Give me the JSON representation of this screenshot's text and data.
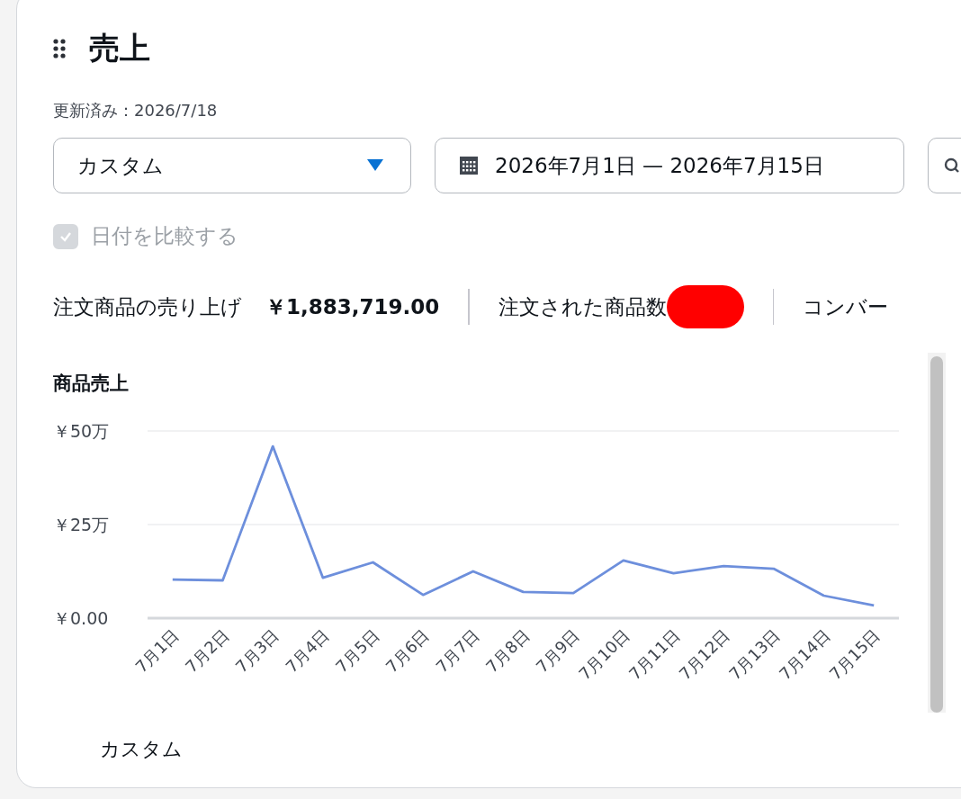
{
  "header": {
    "title": "売上",
    "updated": "更新済み：2026/7/18"
  },
  "controls": {
    "range_select": {
      "value": "カスタム"
    },
    "date_range": {
      "value": "2026年7月1日 — 2026年7月15日"
    },
    "compare": {
      "label": "日付を比較する",
      "checked": true,
      "disabled": true
    }
  },
  "metrics": [
    {
      "label": "注文商品の売り上げ",
      "value": "￥1,883,719.00"
    },
    {
      "label": "注文された商品数",
      "redacted": true
    },
    {
      "label": "コンバー"
    }
  ],
  "chart": {
    "title": "商品売上",
    "chart_data": {
      "type": "line",
      "categories": [
        "7月1日",
        "7月2日",
        "7月3日",
        "7月4日",
        "7月5日",
        "7月6日",
        "7月7日",
        "7月8日",
        "7月9日",
        "7月10日",
        "7月11日",
        "7月12日",
        "7月13日",
        "7月14日",
        "7月15日"
      ],
      "series": [
        {
          "name": "カスタム",
          "color": "#6d8fdc",
          "values": [
            10.3,
            10.1,
            45.9,
            10.8,
            14.9,
            6.2,
            12.5,
            7.0,
            6.7,
            15.4,
            12.0,
            13.9,
            13.2,
            6.0,
            3.4
          ]
        }
      ],
      "ylim": [
        0,
        50
      ],
      "yticks": [
        {
          "value": 0,
          "label": "￥0.00"
        },
        {
          "value": 25,
          "label": "￥25万"
        },
        {
          "value": 50,
          "label": "￥50万"
        }
      ]
    }
  }
}
